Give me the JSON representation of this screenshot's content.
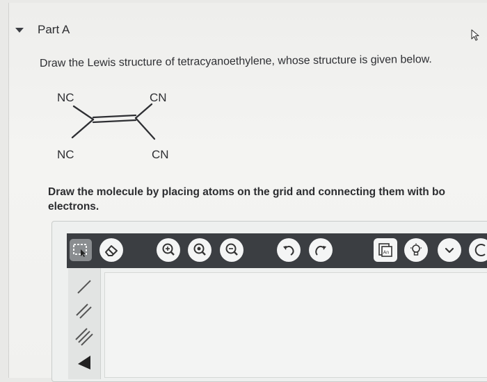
{
  "part": {
    "title": "Part A"
  },
  "question": {
    "text": "Draw the Lewis structure of tetracyanoethylene, whose structure is given below."
  },
  "molecule": {
    "top_left": "NC",
    "top_right": "CN",
    "bottom_left": "NC",
    "bottom_right": "CN"
  },
  "instruction": {
    "line1": "Draw the molecule by placing atoms on the grid and connecting them with bo",
    "line2": "electrons."
  },
  "toolbar": {
    "icons": [
      "select-icon",
      "eraser-icon",
      "zoom-in-icon",
      "zoom-reset-icon",
      "zoom-out-icon",
      "undo-icon",
      "redo-icon",
      "atom-template-icon",
      "hint-icon",
      "chevron-down-icon",
      "more-icon"
    ],
    "template_label": "An"
  },
  "bond_tools": [
    "single-bond-icon",
    "double-bond-icon",
    "triple-bond-icon",
    "wedge-bond-icon"
  ],
  "colors": {
    "toolbar": "#3b3e42",
    "button": "#f4f5f5",
    "text": "#2c2d30"
  }
}
